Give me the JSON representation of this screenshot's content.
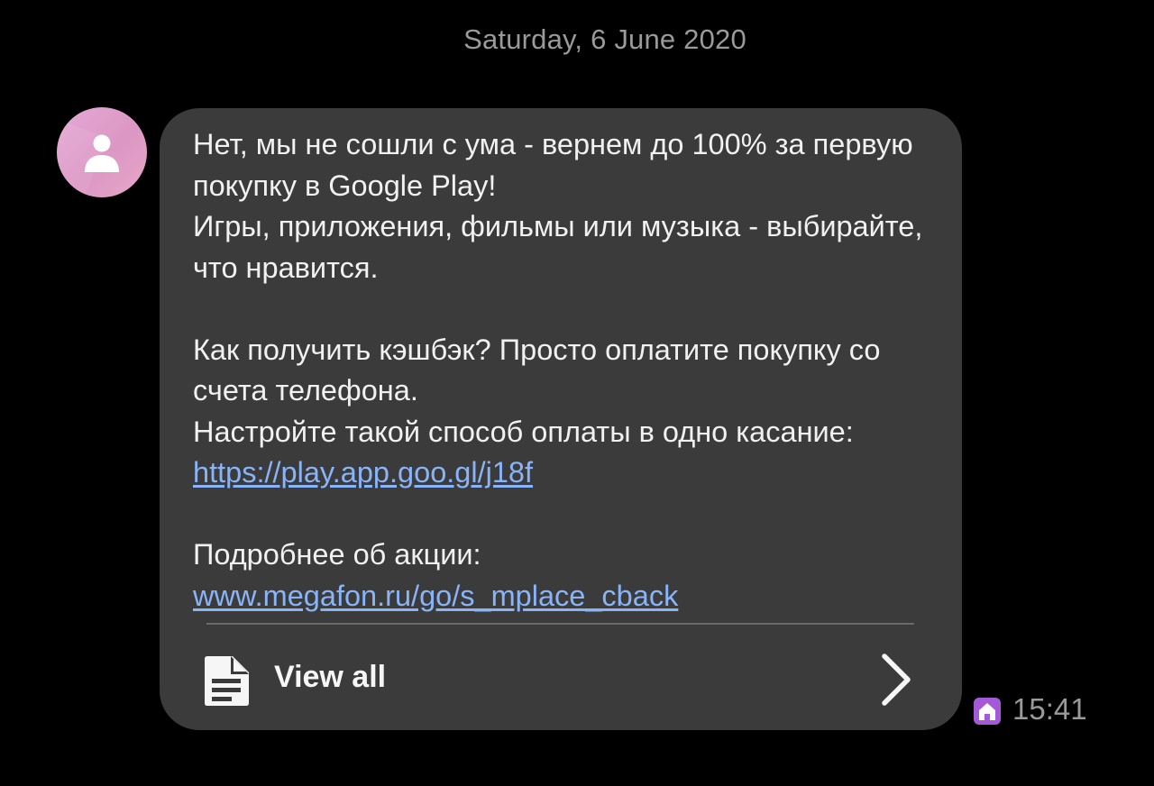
{
  "date_header": "Saturday, 6 June 2020",
  "message": {
    "line1": "Нет, мы не сошли с ума - вернем до 100% за первую покупку в Google Play!",
    "line2": "Игры, приложения, фильмы или музыка - выбирайте, что нравится.",
    "line3": "Как получить кэшбэк? Просто оплатите покупку со счета телефона.",
    "line4_text": "Настройте такой способ оплаты в одно касание: ",
    "line4_link": "https://play.app.goo.gl/j18f",
    "line5_text": "Подробнее об акции: ",
    "line5_link": "www.megafon.ru/go/s_mplace_cback"
  },
  "view_all_label": "View all",
  "time": "15:41",
  "icons": {
    "avatar": "person-icon",
    "view_all": "document-icon",
    "chevron": "chevron-right-icon",
    "sim": "home-sim-icon"
  },
  "colors": {
    "background": "#000000",
    "bubble": "#3b3b3b",
    "link": "#8ab4f8",
    "sim_badge": "#a45ad8",
    "avatar": "#e0a0cc"
  }
}
